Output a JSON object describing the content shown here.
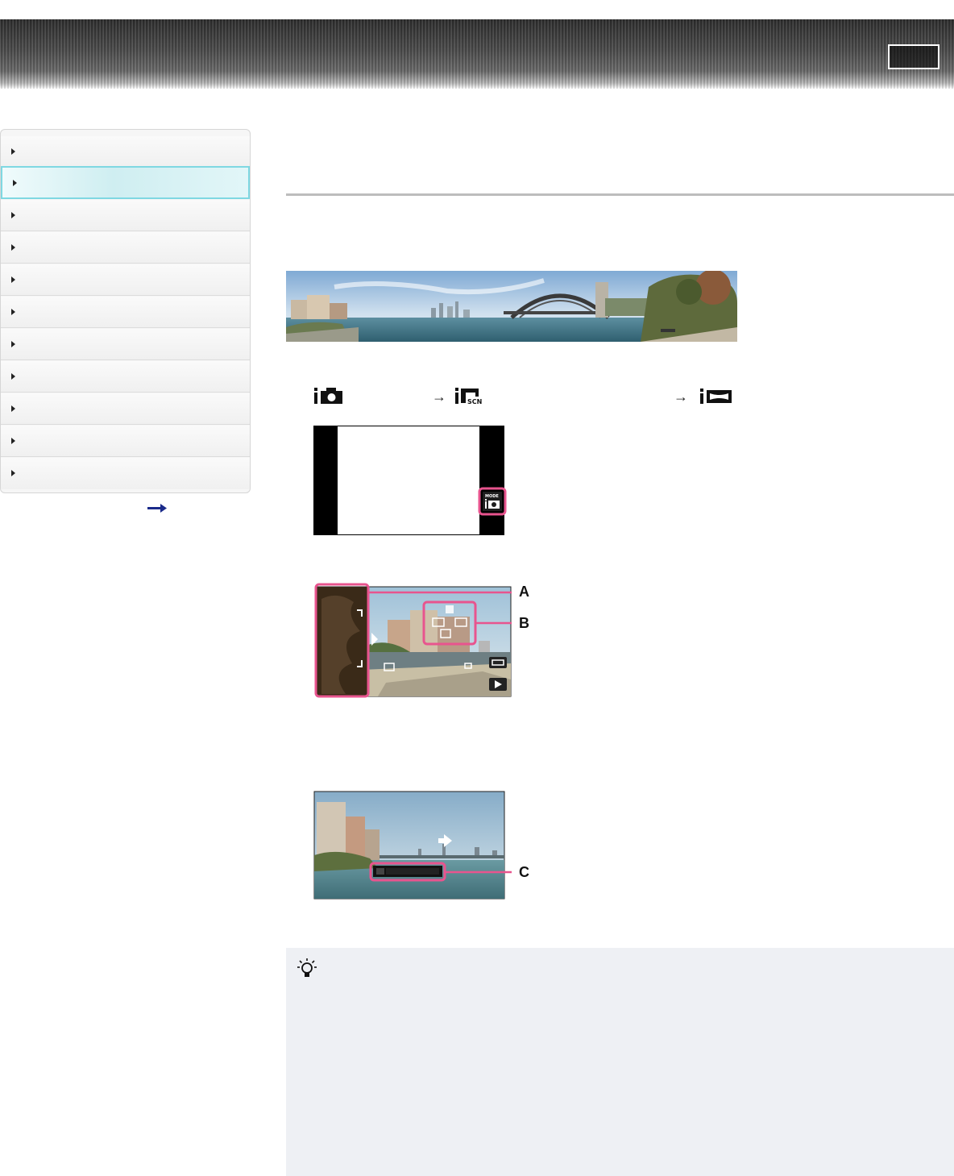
{
  "header": {
    "title": "",
    "right_box_label": ""
  },
  "sidebar": {
    "items": [
      {
        "label": "",
        "active": false
      },
      {
        "label": "",
        "active": true
      },
      {
        "label": "",
        "active": false
      },
      {
        "label": "",
        "active": false
      },
      {
        "label": "",
        "active": false
      },
      {
        "label": "",
        "active": false
      },
      {
        "label": "",
        "active": false
      },
      {
        "label": "",
        "active": false
      },
      {
        "label": "",
        "active": false
      },
      {
        "label": "",
        "active": false
      },
      {
        "label": "",
        "active": false
      }
    ],
    "more_link_icon": "right-arrow-icon"
  },
  "main": {
    "title": "",
    "mode_sequence_icons": [
      "intelligent-auto-icon",
      "superior-auto-scn-icon",
      "intelligent-sweep-panorama-icon"
    ],
    "step1_screen": {
      "mode_button_label": "MODE",
      "mode_icon": "intelligent-auto-icon"
    },
    "step2_screen": {
      "callouts": [
        "A",
        "B"
      ]
    },
    "step3_screen": {
      "callouts": [
        "C"
      ]
    },
    "tip": {
      "icon": "lightbulb-hint-icon",
      "text": ""
    }
  },
  "colors": {
    "accent_pink": "#e8548e",
    "active_cyan": "#7fd8e2",
    "tip_bg": "#eef0f4",
    "header_dark": "#3a3a3a"
  }
}
